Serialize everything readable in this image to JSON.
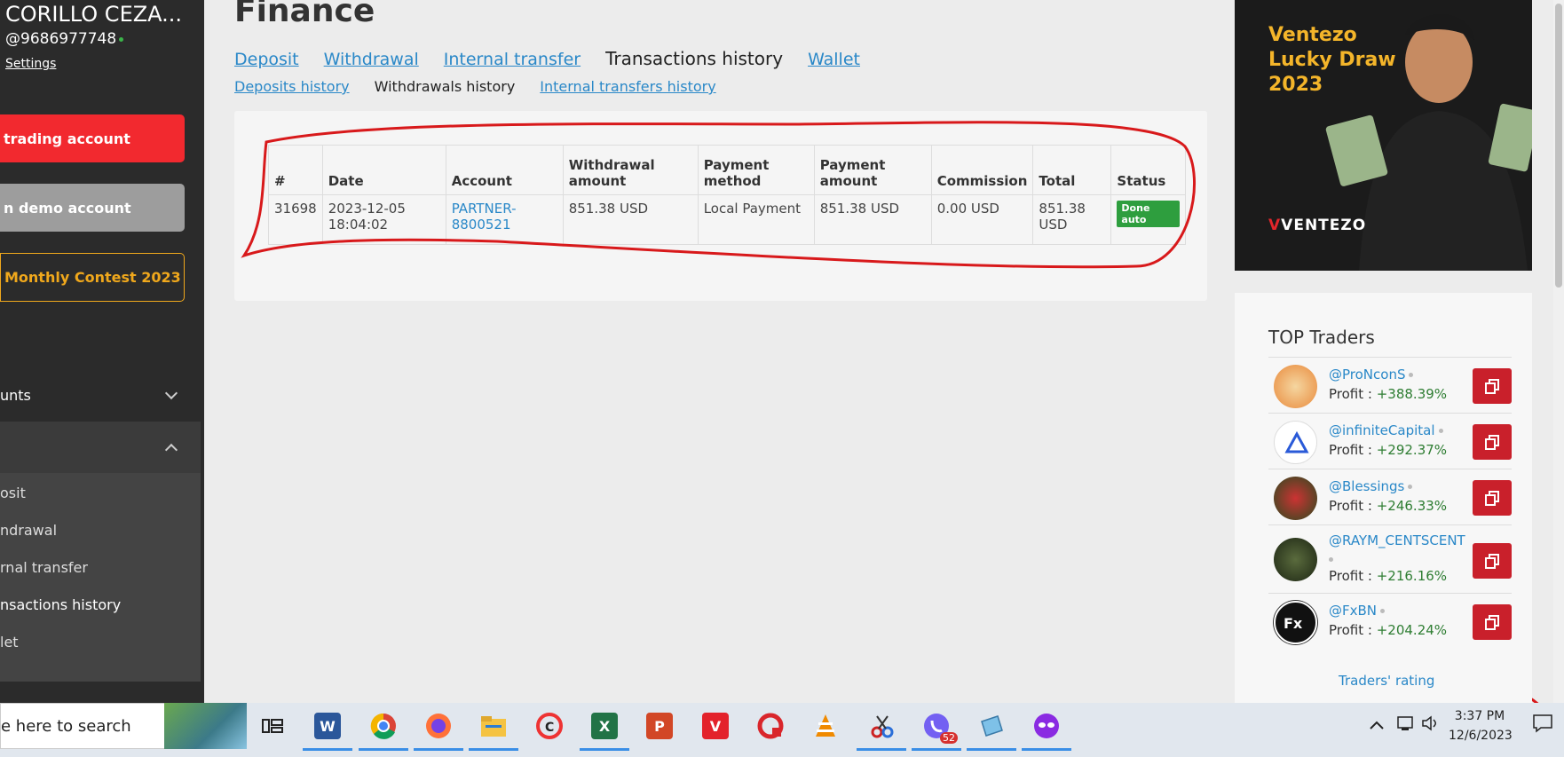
{
  "sidebar": {
    "user_name": "CORILLO CEZA...",
    "user_handle": "@9686977748",
    "settings_label": "Settings",
    "trading_button": "trading account",
    "demo_button": "n demo account",
    "contest_button": "Monthly Contest 2023",
    "accounts_label": "unts",
    "submenu": [
      {
        "label": "osit"
      },
      {
        "label": "ndrawal"
      },
      {
        "label": "rnal transfer"
      },
      {
        "label": "nsactions history"
      },
      {
        "label": "let"
      }
    ]
  },
  "main": {
    "title": "Finance",
    "tabs": [
      {
        "label": "Deposit"
      },
      {
        "label": "Withdrawal"
      },
      {
        "label": "Internal transfer"
      },
      {
        "label": "Transactions history"
      },
      {
        "label": "Wallet"
      }
    ],
    "subtabs": [
      {
        "label": "Deposits history"
      },
      {
        "label": "Withdrawals history"
      },
      {
        "label": "Internal transfers history"
      }
    ],
    "table": {
      "headers": [
        "#",
        "Date",
        "Account",
        "Withdrawal amount",
        "Payment method",
        "Payment amount",
        "Commission",
        "Total",
        "Status"
      ],
      "rows": [
        {
          "id": "31698",
          "date": "2023-12-05 18:04:02",
          "account": "PARTNER-8800521",
          "withdrawal_amount": "851.38 USD",
          "payment_method": "Local Payment",
          "payment_amount": "851.38 USD",
          "commission": "0.00 USD",
          "total": "851.38 USD",
          "status": "Done auto"
        }
      ]
    }
  },
  "ad": {
    "title": "Ventezo Lucky Draw 2023",
    "brand": "VENTEZO"
  },
  "top_traders": {
    "title": "TOP Traders",
    "profit_label": "Profit :",
    "rating_link": "Traders' rating",
    "items": [
      {
        "name": "@ProNconS",
        "profit": "+388.39%"
      },
      {
        "name": "@infiniteCapital",
        "profit": "+292.37%"
      },
      {
        "name": "@Blessings",
        "profit": "+246.33%"
      },
      {
        "name": "@RAYM_CENTSCENT",
        "profit": "+216.16%"
      },
      {
        "name": "@FxBN",
        "profit": "+204.24%"
      }
    ]
  },
  "taskbar": {
    "search_placeholder": "e here to search",
    "time": "3:37 PM",
    "date": "12/6/2023",
    "viber_badge": "52"
  },
  "colors": {
    "sidebar_bg": "#2b2b2b",
    "trading_red": "#f2292f",
    "contest_gold": "#f0a81c",
    "link_blue": "#2a88c8",
    "status_green": "#2e9e3e",
    "copy_red": "#c9202b"
  }
}
